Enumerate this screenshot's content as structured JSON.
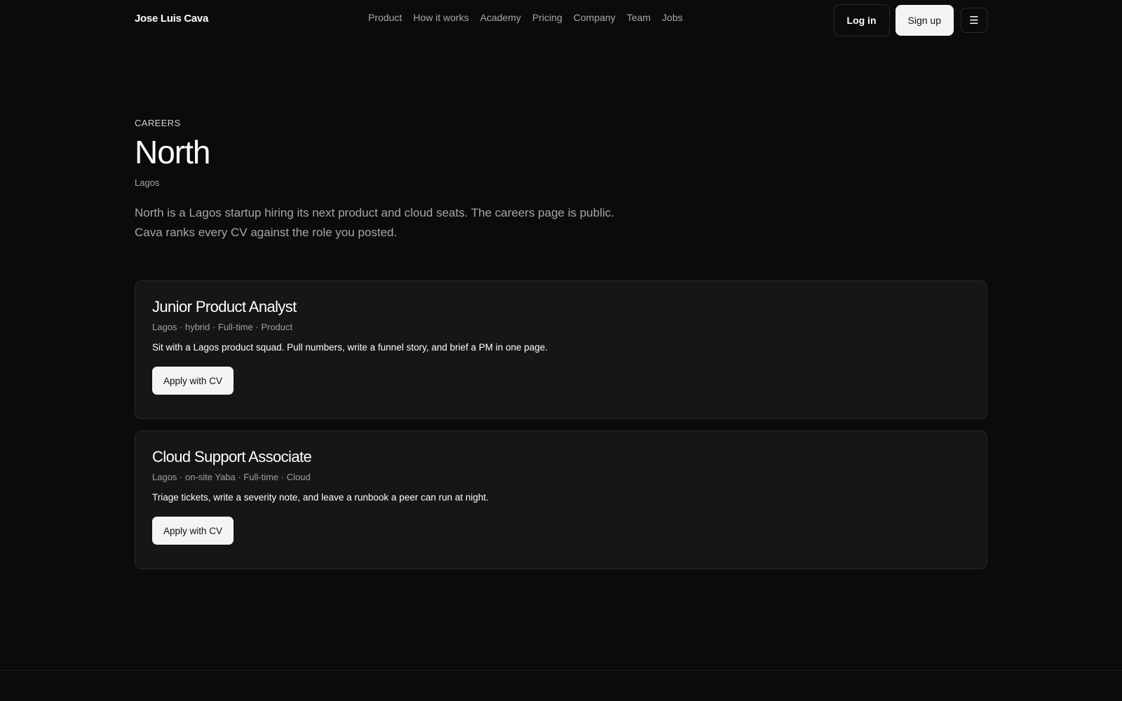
{
  "header": {
    "brand": "Jose Luis Cava",
    "nav": [
      "Product",
      "How it works",
      "Academy",
      "Pricing",
      "Company",
      "Team",
      "Jobs"
    ],
    "login_label": "Log in",
    "signup_label": "Sign up",
    "menu_icon": "hamburger-menu-icon",
    "menu_glyph": "☰"
  },
  "hero": {
    "eyebrow": "CAREERS",
    "title": "North",
    "location": "Lagos",
    "intro_line1": "North is a Lagos startup hiring its next product and cloud seats. The careers page is public.",
    "intro_line2": "Cava ranks every CV against the role you posted."
  },
  "jobs": [
    {
      "title": "Junior Product Analyst",
      "meta": "Lagos · hybrid · Full-time · Product",
      "description": "Sit with a Lagos product squad. Pull numbers, write a funnel story, and brief a PM in one page.",
      "apply_label": "Apply with CV"
    },
    {
      "title": "Cloud Support Associate",
      "meta": "Lagos · on-site Yaba · Full-time · Cloud",
      "description": "Triage tickets, write a severity note, and leave a runbook a peer can run at night.",
      "apply_label": "Apply with CV"
    }
  ],
  "colors": {
    "background": "#0b0b0c",
    "card": "#161618",
    "border": "#27272a",
    "primary_button": "#f4f4f4",
    "muted_text": "#a8a8ad"
  }
}
